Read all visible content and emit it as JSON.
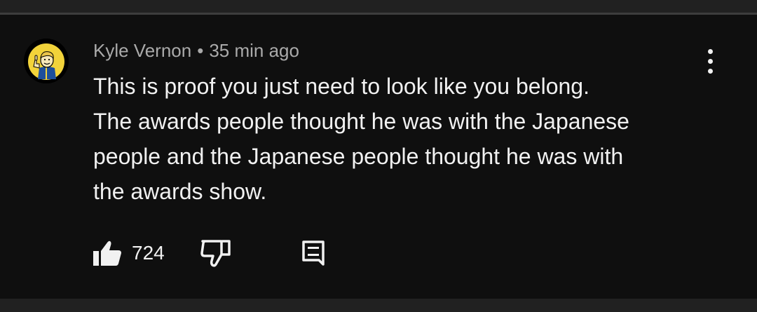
{
  "comment": {
    "author": "Kyle Vernon",
    "separator": "•",
    "timestamp": "35 min ago",
    "text_lines": [
      "This is proof you just need to look like you belong.",
      "The awards people thought he was with the Japanese",
      "people and the Japanese people thought he was with",
      "the awards show."
    ],
    "like_count": "724"
  },
  "icons": {
    "avatar": "vault-boy-thumbs-up",
    "menu": "more-vert-icon",
    "like": "thumb-up-filled-icon",
    "dislike": "thumb-down-outline-icon",
    "reply": "comment-reply-icon"
  },
  "colors": {
    "background": "#0f0f0f",
    "text": "#f1f1f1",
    "meta_text": "#aaaaaa",
    "avatar_yellow": "#f2d33a"
  }
}
